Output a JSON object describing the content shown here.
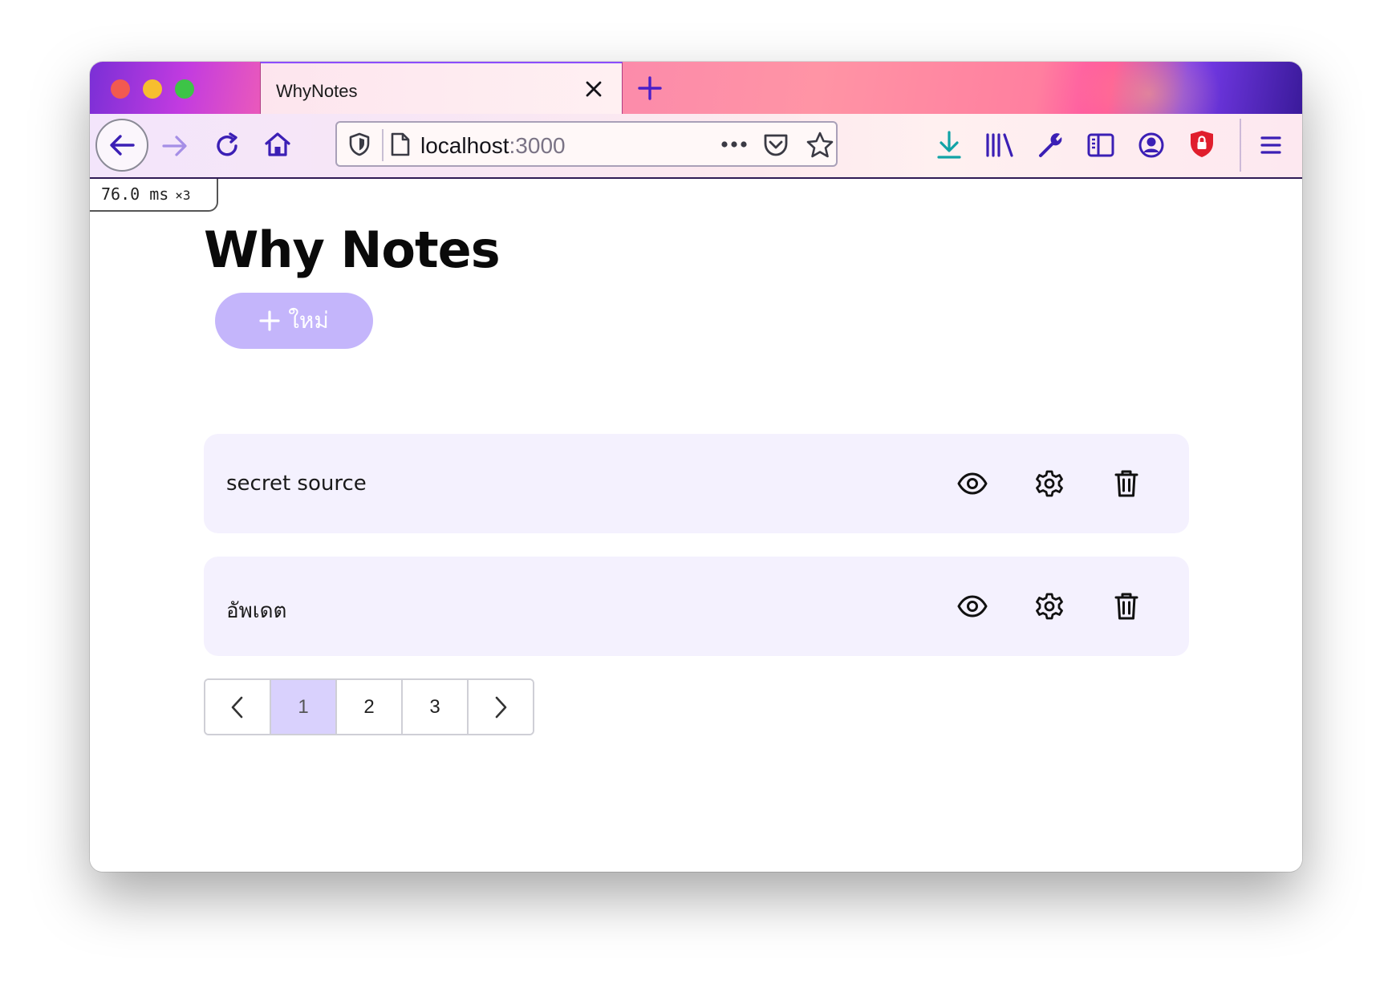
{
  "browser": {
    "tab_title": "WhyNotes",
    "url_host": "localhost",
    "url_port": ":3000",
    "icons": {
      "back": "back-arrow-icon",
      "forward": "forward-arrow-icon",
      "reload": "reload-icon",
      "home": "home-icon",
      "shield": "tracking-shield-icon",
      "page": "page-icon",
      "more": "more-dots-icon",
      "pocket": "pocket-icon",
      "bookmark": "star-icon",
      "downloads": "download-icon",
      "library": "library-icon",
      "devtools": "wrench-icon",
      "sidebar": "sidebar-icon",
      "account": "account-icon",
      "extension": "lock-shield-icon",
      "menu": "hamburger-menu-icon"
    },
    "accent_color": "#5b2bd9"
  },
  "perf_badge": {
    "time": "76.0 ms",
    "multiplier": "×3"
  },
  "app": {
    "title": "Why Notes",
    "new_button_label": "ใหม่",
    "new_button_icon": "plus-icon",
    "button_color": "#c4b5fb",
    "notes": [
      {
        "title": "secret source",
        "actions": [
          "view-icon",
          "settings-icon",
          "delete-icon"
        ]
      },
      {
        "title": "อัพเดต",
        "actions": [
          "view-icon",
          "settings-icon",
          "delete-icon"
        ]
      }
    ],
    "pagination": {
      "prev_icon": "chevron-left-icon",
      "pages": [
        "1",
        "2",
        "3"
      ],
      "current": "1",
      "next_icon": "chevron-right-icon"
    }
  }
}
